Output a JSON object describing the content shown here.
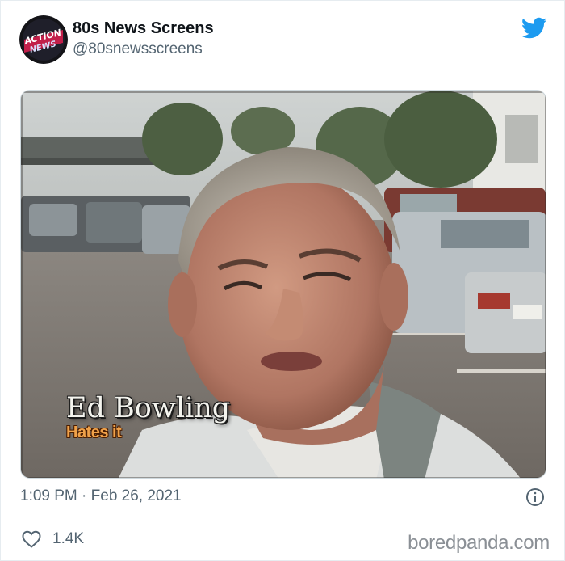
{
  "author": {
    "display_name": "80s News Screens",
    "handle": "@80snewsscreens",
    "avatar_text": "ACTION NEWS"
  },
  "media": {
    "lower_third_name": "Ed Bowling",
    "lower_third_subtitle": "Hates it"
  },
  "meta": {
    "timestamp": "1:09 PM · Feb 26, 2021"
  },
  "engagement": {
    "likes": "1.4K"
  },
  "watermark": "boredpanda.com",
  "icons": {
    "platform": "twitter-bird-icon",
    "info": "info-icon",
    "like": "heart-icon"
  },
  "colors": {
    "twitter_blue": "#1d9bf0",
    "secondary_text": "#536471",
    "lower_third_name": "#f4f4ee",
    "lower_third_subtitle": "#f0a24a"
  }
}
